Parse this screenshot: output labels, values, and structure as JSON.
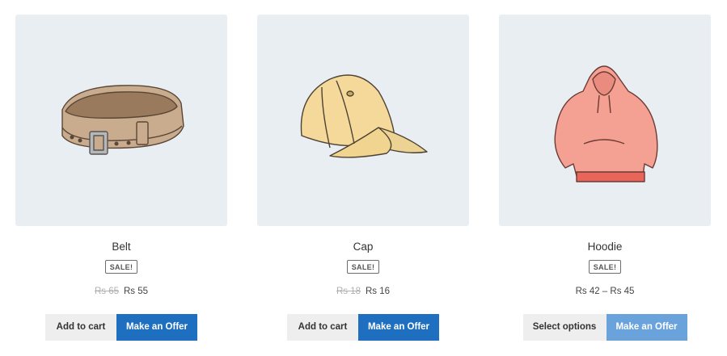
{
  "products": [
    {
      "title": "Belt",
      "badge": "SALE!",
      "price_old": "Rs 65",
      "price_new": "Rs 55",
      "primary_button": "Add to cart",
      "offer_button": "Make an Offer"
    },
    {
      "title": "Cap",
      "badge": "SALE!",
      "price_old": "Rs 18",
      "price_new": "Rs 16",
      "primary_button": "Add to cart",
      "offer_button": "Make an Offer"
    },
    {
      "title": "Hoodie",
      "badge": "SALE!",
      "price_range": "Rs 42 – Rs 45",
      "primary_button": "Select options",
      "offer_button": "Make an Offer"
    }
  ],
  "colors": {
    "thumb_bg": "#e9eef3",
    "offer_button": "#1e6fc0",
    "offer_button_light": "#6aa3dc",
    "secondary_button": "#eeeeee"
  }
}
